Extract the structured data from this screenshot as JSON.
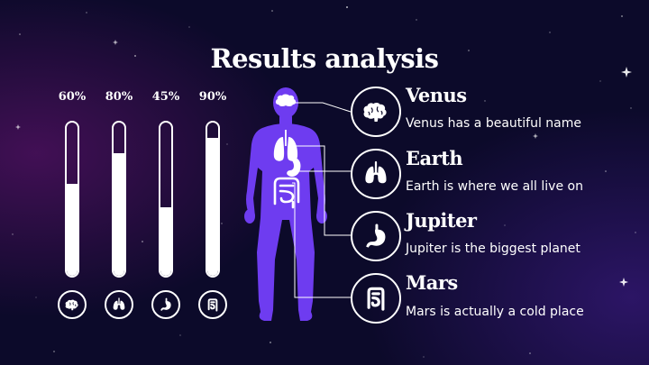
{
  "title": "Results analysis",
  "bars": [
    {
      "label": "60%",
      "value": 0.6,
      "icon": "brain-icon"
    },
    {
      "label": "80%",
      "value": 0.8,
      "icon": "lungs-icon"
    },
    {
      "label": "45%",
      "value": 0.45,
      "icon": "stomach-icon"
    },
    {
      "label": "90%",
      "value": 0.9,
      "icon": "intestine-icon"
    }
  ],
  "items": [
    {
      "title": "Venus",
      "description": "Venus has a beautiful name",
      "icon": "brain-icon"
    },
    {
      "title": "Earth",
      "description": "Earth is where we all live on",
      "icon": "lungs-icon"
    },
    {
      "title": "Jupiter",
      "description": "Jupiter is the biggest planet",
      "icon": "stomach-icon"
    },
    {
      "title": "Mars",
      "description": "Mars is actually a cold place",
      "icon": "intestine-icon"
    }
  ],
  "colors": {
    "background": "#0c0a2a",
    "body": "#6e3cf0",
    "accent": "#ffffff"
  }
}
